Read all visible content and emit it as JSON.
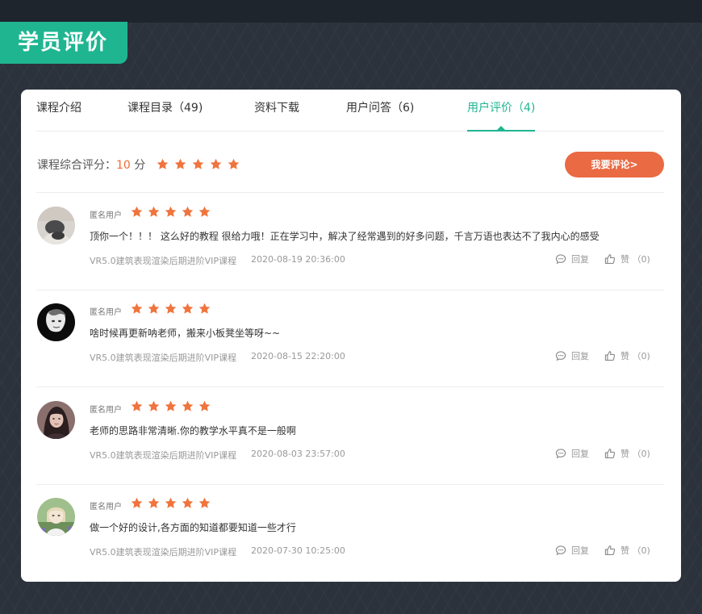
{
  "section_title": "学员评价",
  "tabs": [
    {
      "label": "课程介绍",
      "active": false
    },
    {
      "label": "课程目录（49)",
      "active": false
    },
    {
      "label": "资料下载",
      "active": false
    },
    {
      "label": "用户问答（6)",
      "active": false
    },
    {
      "label": "用户评价（4)",
      "active": true
    }
  ],
  "rating": {
    "label": "课程综合评分：",
    "score": "10",
    "unit": " 分",
    "stars": 5
  },
  "comment_button": "我要评论>",
  "reviews": [
    {
      "username": "匿名用户",
      "stars": 5,
      "text": "顶你一个！！！ 这么好的教程 很给力哦！正在学习中，解决了经常遇到的好多问题，千言万语也表达不了我内心的感受",
      "course": "VR5.0建筑表现渲染后期进阶VIP课程",
      "date": "2020-08-19 20:36:00",
      "reply_label": "回复",
      "like_label": "赞 （0)"
    },
    {
      "username": "匿名用户",
      "stars": 5,
      "text": "啥时候再更新呐老师，搬来小板凳坐等呀~~",
      "course": "VR5.0建筑表现渲染后期进阶VIP课程",
      "date": "2020-08-15 22:20:00",
      "reply_label": "回复",
      "like_label": "赞 （0)"
    },
    {
      "username": "匿名用户",
      "stars": 5,
      "text": "老师的思路非常清晰.你的教学水平真不是一般啊",
      "course": "VR5.0建筑表现渲染后期进阶VIP课程",
      "date": "2020-08-03 23:57:00",
      "reply_label": "回复",
      "like_label": "赞 （0)"
    },
    {
      "username": "匿名用户",
      "stars": 5,
      "text": "做一个好的设计,各方面的知道都要知道一些才行",
      "course": "VR5.0建筑表现渲染后期进阶VIP课程",
      "date": "2020-07-30 10:25:00",
      "reply_label": "回复",
      "like_label": "赞 （0)"
    }
  ],
  "colors": {
    "accent": "#1fb591",
    "star": "#f0743d",
    "button": "#e96a43",
    "score": "#f06a35"
  },
  "icons": {
    "star": "star-icon",
    "reply": "speech-bubble-icon",
    "like": "thumbs-up-icon"
  }
}
